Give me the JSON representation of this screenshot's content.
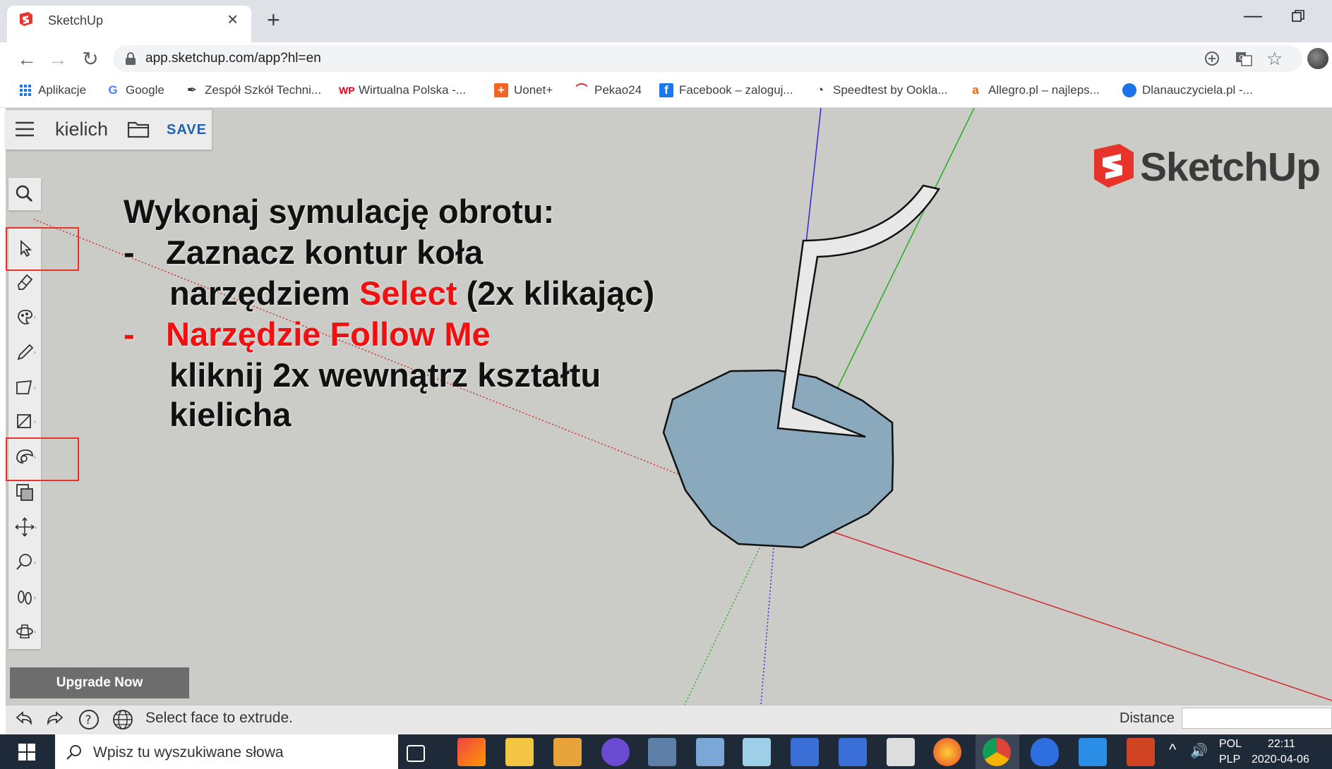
{
  "browser": {
    "tab_title": "SketchUp",
    "url": "app.sketchup.com/app?hl=en",
    "bookmarks": [
      {
        "label": "Aplikacje",
        "icon": "apps-grid-icon"
      },
      {
        "label": "Google",
        "icon": "google-icon"
      },
      {
        "label": "Zespół Szkół Techni...",
        "icon": "school-icon"
      },
      {
        "label": "Wirtualna Polska -...",
        "icon": "wp-icon"
      },
      {
        "label": "Uonet+",
        "icon": "uonet-icon"
      },
      {
        "label": "Pekao24",
        "icon": "pekao-icon"
      },
      {
        "label": "Facebook – zaloguj...",
        "icon": "facebook-icon"
      },
      {
        "label": "Speedtest by Ookla...",
        "icon": "speedtest-icon"
      },
      {
        "label": "Allegro.pl – najleps...",
        "icon": "allegro-icon"
      },
      {
        "label": "Dlanauczyciela.pl -...",
        "icon": "dlanauczyciela-icon"
      }
    ]
  },
  "app": {
    "model_name": "kielich",
    "save_label": "SAVE",
    "logo_text": "SketchUp",
    "upgrade_label": "Upgrade Now",
    "status_text": "Select face to extrude.",
    "distance_label": "Distance",
    "distance_value": ""
  },
  "instructions": {
    "line1": "Wykonaj symulację obrotu:",
    "line2_dash": "-",
    "line2": "Zaznacz kontur koła",
    "line3_a": "narzędziem ",
    "line3_b": "Select",
    "line3_c": " (2x klikając)",
    "line4_dash": "-",
    "line4": "Narzędzie Follow Me",
    "line5": "kliknij 2x wewnątrz kształtu",
    "line6": "kielicha"
  },
  "taskbar": {
    "search_placeholder": "Wpisz tu wyszukiwane słowa",
    "lang_top": "POL",
    "lang_bottom": "PLP",
    "time": "22:11",
    "date": "2020-04-06"
  },
  "colors": {
    "accent_red": "#f20f0f",
    "save_blue": "#2063b0",
    "face_blue": "#8aa9bd",
    "viewport_bg": "#cbcbc7"
  }
}
